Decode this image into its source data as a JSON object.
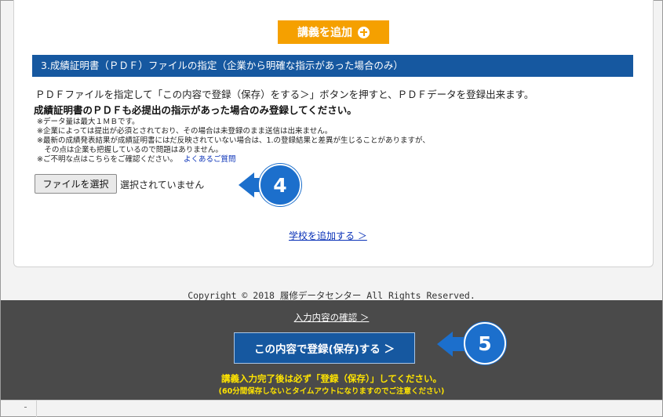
{
  "buttons": {
    "add_lecture": "講義を追加",
    "choose_file": "ファイルを選択",
    "register": "この内容で登録(保存)する ＞"
  },
  "section": {
    "title": "3.成績証明書（ＰＤＦ）ファイルの指定（企業から明確な指示があった場合のみ）",
    "instruction": "ＰＤＦファイルを指定して「この内容で登録（保存）をする＞」ボタンを押すと、ＰＤＦデータを登録出来ます。",
    "bold_note": "成績証明書のＰＤＦも必提出の指示があった場合のみ登録してください。",
    "notes": [
      "※データ量は最大１ＭＢです。",
      "※企業によっては提出が必須とされており、その場合は未登録のまま送信は出来ません。",
      "※最新の成績発表結果が成績証明書にはだ反映されていない場合は、1.の登録結果と差異が生じることがありますが、",
      "　その点は企業も把握しているので問題はありません。",
      "※ご不明な点はこちらをご確認ください。"
    ],
    "faq_link": "よくあるご質問",
    "file_status": "選択されていません"
  },
  "links": {
    "add_school": "学校を追加する ＞",
    "confirm_input": "入力内容の確認 ＞"
  },
  "footer": {
    "copyright": "Copyright © 2018 履修データセンター All Rights Reserved.",
    "warning": "講義入力完了後は必ず「登録（保存）」してください。",
    "warning_sub": "(60分間保存しないとタイムアウトになりますのでご注意ください)"
  },
  "callouts": {
    "step4": "4",
    "step5": "5"
  },
  "colors": {
    "section_bar": "#1658a0",
    "add_button": "#f5a000",
    "register_button": "#1658a0",
    "callout": "#1c6fcc",
    "warning_text": "#ffe400",
    "footer_bg": "#4a4a4a",
    "link": "#0a32b8"
  },
  "icons": {
    "add": "plus-circle-icon",
    "callout_arrow": "left-arrow-icon"
  }
}
